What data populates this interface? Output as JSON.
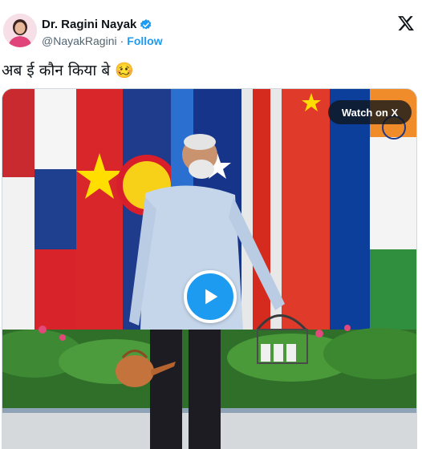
{
  "author": {
    "display_name": "Dr. Ragini Nayak",
    "handle": "@NayakRagini",
    "separator": "·",
    "follow_label": "Follow",
    "verified": true
  },
  "tweet": {
    "text": "अब ई कौन किया बे 🥴"
  },
  "media": {
    "type": "video",
    "watch_label": "Watch on X"
  },
  "icons": {
    "verified": "verified-badge-icon",
    "x_logo": "x-logo-icon",
    "play": "play-icon"
  },
  "colors": {
    "accent": "#1d9bf0",
    "text": "#0f1419",
    "muted": "#536471"
  }
}
